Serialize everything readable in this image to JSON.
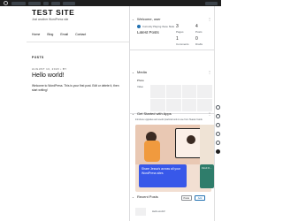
{
  "adminbar": {
    "items": [
      "Test Site",
      "Customize",
      "0",
      "New",
      "Edit Site"
    ]
  },
  "site": {
    "title": "TEST SITE",
    "tagline": "Just another WordPress site",
    "nav": [
      "Home",
      "Blog",
      "Email",
      "Contact"
    ],
    "section_label": "POSTS",
    "post": {
      "date": "AUGUST 13, 2023 • BY",
      "title": "Hello world!",
      "excerpt": "Welcome to WordPress. This is your first post. Edit or delete it, then start writing!"
    }
  },
  "panel": {
    "welcome": {
      "header": "Welcome, user",
      "line1": "Currently Playing these Stats",
      "latest_label": "Latest Posts",
      "stats": [
        {
          "num": "3",
          "label": "Pages"
        },
        {
          "num": "4",
          "label": "Posts"
        },
        {
          "num": "1",
          "label": "Comments"
        },
        {
          "num": "0",
          "label": "Drafts"
        }
      ]
    },
    "media": {
      "header": "Media",
      "tab1": "Photo",
      "tab2": "Video"
    },
    "apps": {
      "header": "Get Started with Apps",
      "intro": "Introduce upgrades and useful practical tools to use from Header Cards",
      "cta": "Share Jessa's across all your WordPress sites",
      "side": "Find O..."
    },
    "recent": {
      "header": "Recent Posts",
      "select": "Posts",
      "button": "Add",
      "item": "Hello world!"
    }
  }
}
